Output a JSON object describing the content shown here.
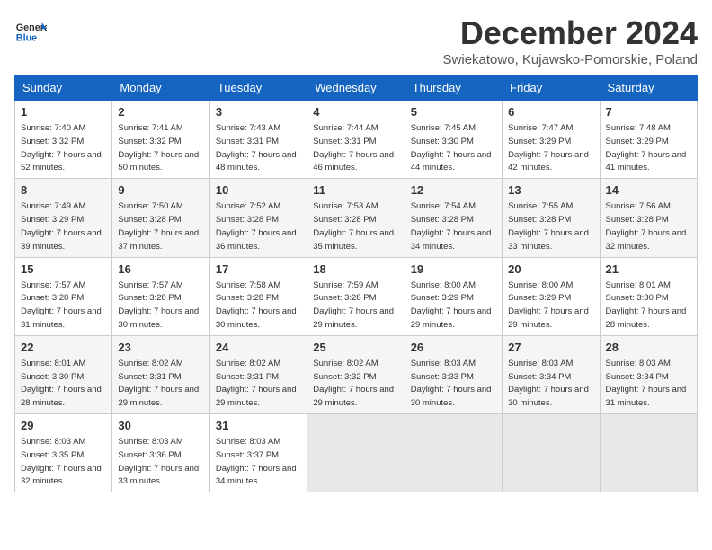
{
  "header": {
    "logo_line1": "General",
    "logo_line2": "Blue",
    "month_title": "December 2024",
    "location": "Swiekatowo, Kujawsko-Pomorskie, Poland"
  },
  "days_of_week": [
    "Sunday",
    "Monday",
    "Tuesday",
    "Wednesday",
    "Thursday",
    "Friday",
    "Saturday"
  ],
  "weeks": [
    [
      {
        "day": "1",
        "sunrise": "Sunrise: 7:40 AM",
        "sunset": "Sunset: 3:32 PM",
        "daylight": "Daylight: 7 hours and 52 minutes."
      },
      {
        "day": "2",
        "sunrise": "Sunrise: 7:41 AM",
        "sunset": "Sunset: 3:32 PM",
        "daylight": "Daylight: 7 hours and 50 minutes."
      },
      {
        "day": "3",
        "sunrise": "Sunrise: 7:43 AM",
        "sunset": "Sunset: 3:31 PM",
        "daylight": "Daylight: 7 hours and 48 minutes."
      },
      {
        "day": "4",
        "sunrise": "Sunrise: 7:44 AM",
        "sunset": "Sunset: 3:31 PM",
        "daylight": "Daylight: 7 hours and 46 minutes."
      },
      {
        "day": "5",
        "sunrise": "Sunrise: 7:45 AM",
        "sunset": "Sunset: 3:30 PM",
        "daylight": "Daylight: 7 hours and 44 minutes."
      },
      {
        "day": "6",
        "sunrise": "Sunrise: 7:47 AM",
        "sunset": "Sunset: 3:29 PM",
        "daylight": "Daylight: 7 hours and 42 minutes."
      },
      {
        "day": "7",
        "sunrise": "Sunrise: 7:48 AM",
        "sunset": "Sunset: 3:29 PM",
        "daylight": "Daylight: 7 hours and 41 minutes."
      }
    ],
    [
      {
        "day": "8",
        "sunrise": "Sunrise: 7:49 AM",
        "sunset": "Sunset: 3:29 PM",
        "daylight": "Daylight: 7 hours and 39 minutes."
      },
      {
        "day": "9",
        "sunrise": "Sunrise: 7:50 AM",
        "sunset": "Sunset: 3:28 PM",
        "daylight": "Daylight: 7 hours and 37 minutes."
      },
      {
        "day": "10",
        "sunrise": "Sunrise: 7:52 AM",
        "sunset": "Sunset: 3:28 PM",
        "daylight": "Daylight: 7 hours and 36 minutes."
      },
      {
        "day": "11",
        "sunrise": "Sunrise: 7:53 AM",
        "sunset": "Sunset: 3:28 PM",
        "daylight": "Daylight: 7 hours and 35 minutes."
      },
      {
        "day": "12",
        "sunrise": "Sunrise: 7:54 AM",
        "sunset": "Sunset: 3:28 PM",
        "daylight": "Daylight: 7 hours and 34 minutes."
      },
      {
        "day": "13",
        "sunrise": "Sunrise: 7:55 AM",
        "sunset": "Sunset: 3:28 PM",
        "daylight": "Daylight: 7 hours and 33 minutes."
      },
      {
        "day": "14",
        "sunrise": "Sunrise: 7:56 AM",
        "sunset": "Sunset: 3:28 PM",
        "daylight": "Daylight: 7 hours and 32 minutes."
      }
    ],
    [
      {
        "day": "15",
        "sunrise": "Sunrise: 7:57 AM",
        "sunset": "Sunset: 3:28 PM",
        "daylight": "Daylight: 7 hours and 31 minutes."
      },
      {
        "day": "16",
        "sunrise": "Sunrise: 7:57 AM",
        "sunset": "Sunset: 3:28 PM",
        "daylight": "Daylight: 7 hours and 30 minutes."
      },
      {
        "day": "17",
        "sunrise": "Sunrise: 7:58 AM",
        "sunset": "Sunset: 3:28 PM",
        "daylight": "Daylight: 7 hours and 30 minutes."
      },
      {
        "day": "18",
        "sunrise": "Sunrise: 7:59 AM",
        "sunset": "Sunset: 3:28 PM",
        "daylight": "Daylight: 7 hours and 29 minutes."
      },
      {
        "day": "19",
        "sunrise": "Sunrise: 8:00 AM",
        "sunset": "Sunset: 3:29 PM",
        "daylight": "Daylight: 7 hours and 29 minutes."
      },
      {
        "day": "20",
        "sunrise": "Sunrise: 8:00 AM",
        "sunset": "Sunset: 3:29 PM",
        "daylight": "Daylight: 7 hours and 29 minutes."
      },
      {
        "day": "21",
        "sunrise": "Sunrise: 8:01 AM",
        "sunset": "Sunset: 3:30 PM",
        "daylight": "Daylight: 7 hours and 28 minutes."
      }
    ],
    [
      {
        "day": "22",
        "sunrise": "Sunrise: 8:01 AM",
        "sunset": "Sunset: 3:30 PM",
        "daylight": "Daylight: 7 hours and 28 minutes."
      },
      {
        "day": "23",
        "sunrise": "Sunrise: 8:02 AM",
        "sunset": "Sunset: 3:31 PM",
        "daylight": "Daylight: 7 hours and 29 minutes."
      },
      {
        "day": "24",
        "sunrise": "Sunrise: 8:02 AM",
        "sunset": "Sunset: 3:31 PM",
        "daylight": "Daylight: 7 hours and 29 minutes."
      },
      {
        "day": "25",
        "sunrise": "Sunrise: 8:02 AM",
        "sunset": "Sunset: 3:32 PM",
        "daylight": "Daylight: 7 hours and 29 minutes."
      },
      {
        "day": "26",
        "sunrise": "Sunrise: 8:03 AM",
        "sunset": "Sunset: 3:33 PM",
        "daylight": "Daylight: 7 hours and 30 minutes."
      },
      {
        "day": "27",
        "sunrise": "Sunrise: 8:03 AM",
        "sunset": "Sunset: 3:34 PM",
        "daylight": "Daylight: 7 hours and 30 minutes."
      },
      {
        "day": "28",
        "sunrise": "Sunrise: 8:03 AM",
        "sunset": "Sunset: 3:34 PM",
        "daylight": "Daylight: 7 hours and 31 minutes."
      }
    ],
    [
      {
        "day": "29",
        "sunrise": "Sunrise: 8:03 AM",
        "sunset": "Sunset: 3:35 PM",
        "daylight": "Daylight: 7 hours and 32 minutes."
      },
      {
        "day": "30",
        "sunrise": "Sunrise: 8:03 AM",
        "sunset": "Sunset: 3:36 PM",
        "daylight": "Daylight: 7 hours and 33 minutes."
      },
      {
        "day": "31",
        "sunrise": "Sunrise: 8:03 AM",
        "sunset": "Sunset: 3:37 PM",
        "daylight": "Daylight: 7 hours and 34 minutes."
      },
      null,
      null,
      null,
      null
    ]
  ]
}
